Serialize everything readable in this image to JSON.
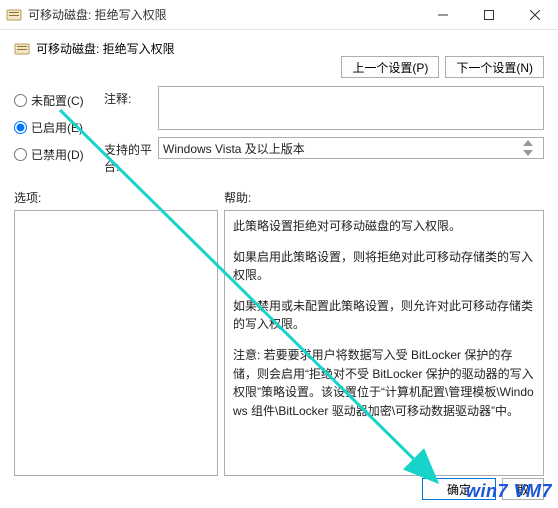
{
  "titlebar": {
    "title": "可移动磁盘: 拒绝写入权限"
  },
  "header": {
    "setting_name": "可移动磁盘: 拒绝写入权限"
  },
  "nav": {
    "prev": "上一个设置(P)",
    "next": "下一个设置(N)"
  },
  "radios": {
    "not_configured": "未配置(C)",
    "enabled": "已启用(E)",
    "disabled": "已禁用(D)"
  },
  "fields": {
    "comment_label": "注释:",
    "comment_value": "",
    "platform_label": "支持的平台:",
    "platform_value": "Windows Vista 及以上版本"
  },
  "split": {
    "options_label": "选项:",
    "help_label": "帮助:"
  },
  "help": {
    "p1": "此策略设置拒绝对可移动磁盘的写入权限。",
    "p2": "如果启用此策略设置，则将拒绝对此可移动存储类的写入权限。",
    "p3": "如果禁用或未配置此策略设置，则允许对此可移动存储类的写入权限。",
    "p4": "注意: 若要要求用户将数据写入受 BitLocker 保护的存储，则会启用“拒绝对不受 BitLocker 保护的驱动器的写入权限”策略设置。该设置位于“计算机配置\\管理模板\\Windows 组件\\BitLocker 驱动器加密\\可移动数据驱动器”中。"
  },
  "footer": {
    "ok": "确定",
    "cancel_visible": "取"
  },
  "watermark": "win7 VM7"
}
